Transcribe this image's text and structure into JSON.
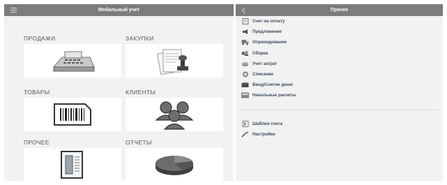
{
  "left_panel": {
    "title": "Мобильный учет",
    "tiles": [
      {
        "label": "ПРОДАЖИ",
        "icon": "cash-register-icon"
      },
      {
        "label": "ЗАКУПКИ",
        "icon": "stamp-documents-icon"
      },
      {
        "label": "ТОВАРЫ",
        "icon": "barcode-icon"
      },
      {
        "label": "КЛИЕНТЫ",
        "icon": "people-icon"
      },
      {
        "label": "ПРОЧЕЕ",
        "icon": "document-thermometer-icon"
      },
      {
        "label": "ОТЧЕТЫ",
        "icon": "pie-chart-icon"
      }
    ]
  },
  "right_panel": {
    "title": "Прочее",
    "items": [
      {
        "label": "Счет на оплату",
        "icon": "invoice-icon"
      },
      {
        "label": "Предложение",
        "icon": "megaphone-icon"
      },
      {
        "label": "Оприходование",
        "icon": "truck-icon"
      },
      {
        "label": "Сборка",
        "icon": "assembly-icon"
      },
      {
        "label": "Учет затрат",
        "icon": "coins-icon"
      },
      {
        "label": "Списание",
        "icon": "write-off-icon"
      },
      {
        "label": "Ввод/Снятие денег",
        "icon": "cash-icon"
      },
      {
        "label": "Начальные расчеты",
        "icon": "calculator-icon"
      }
    ],
    "items2": [
      {
        "label": "Шаблон счета",
        "icon": "template-icon"
      },
      {
        "label": "Настройки",
        "icon": "settings-wand-icon"
      }
    ]
  },
  "colors": {
    "header": "#7c7c7c",
    "panel": "#f2f2f2",
    "tile": "#ffffff",
    "list_text": "#3e4d5e"
  }
}
